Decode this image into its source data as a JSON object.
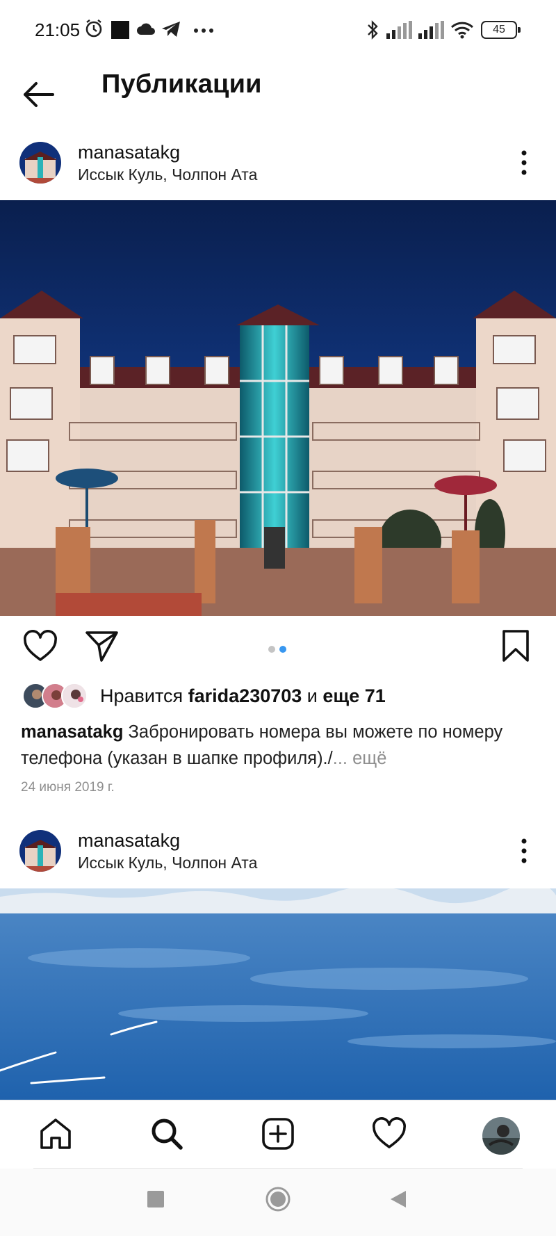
{
  "status_bar": {
    "time": "21:05",
    "battery": "45",
    "icons": [
      "alarm-icon",
      "notification-square-icon",
      "cloud-icon",
      "telegram-icon",
      "more-dots-icon",
      "bluetooth-icon",
      "signal-icon",
      "signal-icon",
      "wifi-icon",
      "battery-icon"
    ]
  },
  "header": {
    "title": "Публикации",
    "back_icon": "arrow-left-icon"
  },
  "posts": [
    {
      "username": "manasatakg",
      "location": "Иссык Куль, Чолпон Ата",
      "image": "hotel-building-photo",
      "carousel": {
        "count": 2,
        "active": 2
      },
      "likes": {
        "prefix": "Нравится",
        "user": "farida230703",
        "connector": "и",
        "others": "еще 71"
      },
      "caption": {
        "username": "manasatakg",
        "text": "Забронировать номера вы можете по номеру телефона (указан в шапке профиля)./",
        "more": "... ещё"
      },
      "date": "24 июня 2019 г."
    },
    {
      "username": "manasatakg",
      "location": "Иссык Куль, Чолпон Ата",
      "image": "lake-photo"
    }
  ],
  "bottom_nav": {
    "items": [
      "home-icon",
      "search-icon",
      "add-post-icon",
      "activity-heart-icon",
      "profile-avatar"
    ]
  },
  "colors": {
    "accent": "#3897f0",
    "muted_text": "#8e8e8e",
    "sky": "#0d2c66",
    "lake": "#2a6fb8"
  }
}
